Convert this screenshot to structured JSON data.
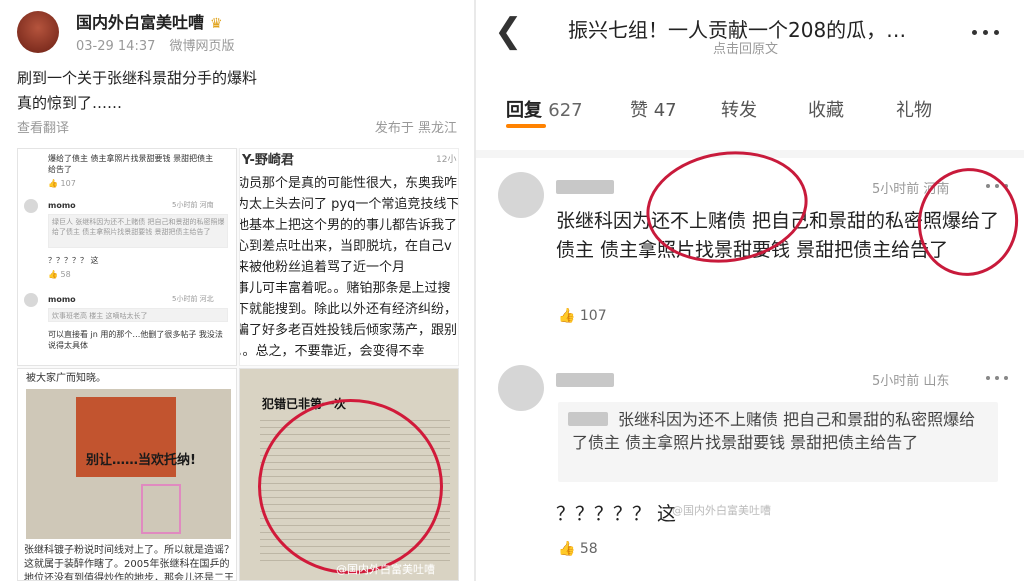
{
  "left": {
    "user": {
      "name": "国内外白富美吐嘈",
      "badge_icon": "crown-icon"
    },
    "meta": {
      "time": "03-29 14:37",
      "source": "微博网页版"
    },
    "post": {
      "line1": "刷到一个关于张继科景甜分手的爆料",
      "line2": "真的惊到了……"
    },
    "actions": {
      "translate": "查看翻译",
      "location": "发布于 黑龙江"
    },
    "thumb1": {
      "text1": "爆给了债主 债主拿照片找景甜要钱 景甜把债主",
      "text2": "给告了",
      "likes": "107",
      "user2": "momo",
      "time2": "5小时前 河南",
      "quote": "绿巨人 张继科因为还不上赌债 把自己和景甜的私密照爆给了债主 债主拿照片找景甜要钱 景甜把债主给告了",
      "text3": "？？？？？ 这",
      "likes2": "58",
      "user3": "momo",
      "time3": "5小时前 河北",
      "quote3": "炊事班老高 楼主 这嘀咕太长了",
      "text4": "可以直接看 jn 用的那个…他删了很多帖子 我没法说得太具体"
    },
    "thumb2": {
      "header": "Y-野崎君",
      "time": "12小",
      "lines": [
        "动员那个是真的可能性很大，东奥我咋",
        "为太上头去问了 pyq一个常追竞技线下",
        "他基本上把这个男的的事儿都告诉我了",
        "心到差点吐出来，当即脱坑，在自己v",
        "来被他粉丝追着骂了近一个月",
        "事儿可丰富着呢。。赌铂那条是上过搜",
        "下就能搜到。除此以外还有经济纠纷，",
        "骗了好多老百姓投钱后倾家荡产，跟别",
        "。。总之，不要靠近，会变得不幸"
      ]
    },
    "thumb3": {
      "top": "被大家广而知晓。",
      "headline": "别让……当欢托纳!",
      "caption": "张继科镀子粉说时间线对上了。所以就是造谣？这就属于装醉作瞎了。2005年张继科在国乒的地位还没有到值得炒作的地步，那会儿还是二王一马这些老家伙在顶……"
    },
    "thumb4": {
      "headline": "犯错已非第一次",
      "watermark": "@国内外白富美吐嘈"
    }
  },
  "right": {
    "title": "振兴七组！一人贡献一个208的瓜，…",
    "subtitle": "点击回原文",
    "tabs": [
      {
        "label": "回复",
        "count": "627"
      },
      {
        "label": "赞",
        "count": "47"
      },
      {
        "label": "转发",
        "count": ""
      },
      {
        "label": "收藏",
        "count": ""
      },
      {
        "label": "礼物",
        "count": ""
      }
    ],
    "comment1": {
      "time": "5小时前 河南",
      "text": "张继科因为还不上赌债 把自己和景甜的私密照爆给了债主 债主拿照片找景甜要钱 景甜把债主给告了",
      "likes": "107"
    },
    "comment2": {
      "time": "5小时前 山东",
      "quote": "张继科因为还不上赌债 把自己和景甜的私密照爆给了债主 债主拿照片找景甜要钱 景甜把债主给告了",
      "text": "？？？？？ 这",
      "likes": "58",
      "watermark": "@国内外白富美吐嘈"
    }
  },
  "colors": {
    "accent": "#ff8200",
    "annotation": "#d11a3a",
    "meta": "#999999"
  }
}
